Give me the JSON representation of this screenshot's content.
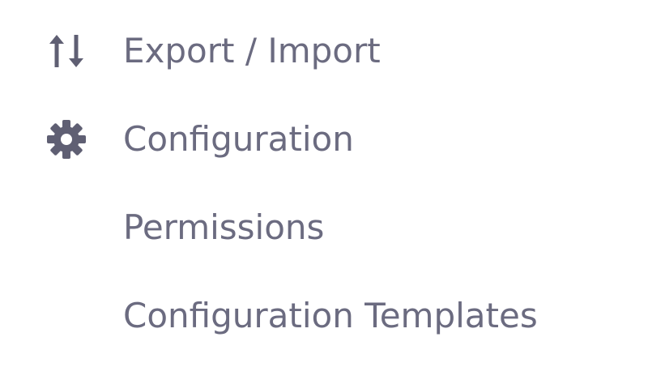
{
  "menu": {
    "items": [
      {
        "label": "Export / Import",
        "icon": "sort-arrows-icon"
      },
      {
        "label": "Configuration",
        "icon": "gear-icon"
      },
      {
        "label": "Permissions",
        "icon": ""
      },
      {
        "label": "Configuration Templates",
        "icon": ""
      }
    ]
  },
  "colors": {
    "text": "#6b6b80",
    "icon": "#5f5f73",
    "background": "#ffffff"
  }
}
